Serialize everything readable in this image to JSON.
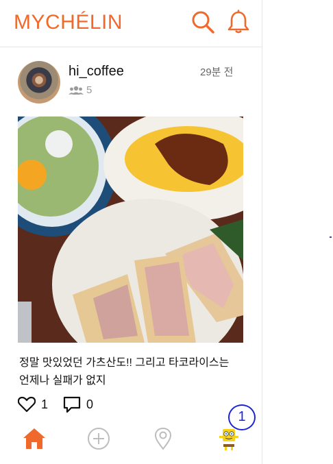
{
  "app": {
    "brand": "MYCHÉLIN"
  },
  "header": {
    "icons": [
      "search-icon",
      "bell-icon"
    ],
    "accent_color": "#f0692c"
  },
  "post": {
    "username": "hi_coffee",
    "followers_count": "5",
    "time_ago": "29분 전",
    "caption_line1": "정말 맛있었던 가츠산도!! 그리고 타코라이스는",
    "caption_line2": "언제나 실패가 없지",
    "likes_count": "1",
    "comments_count": "0"
  },
  "tabbar": {
    "items": [
      "home-icon",
      "add-icon",
      "map-pin-icon",
      "profile-avatar"
    ],
    "active": "home-icon"
  },
  "annotation": {
    "label": "1"
  }
}
